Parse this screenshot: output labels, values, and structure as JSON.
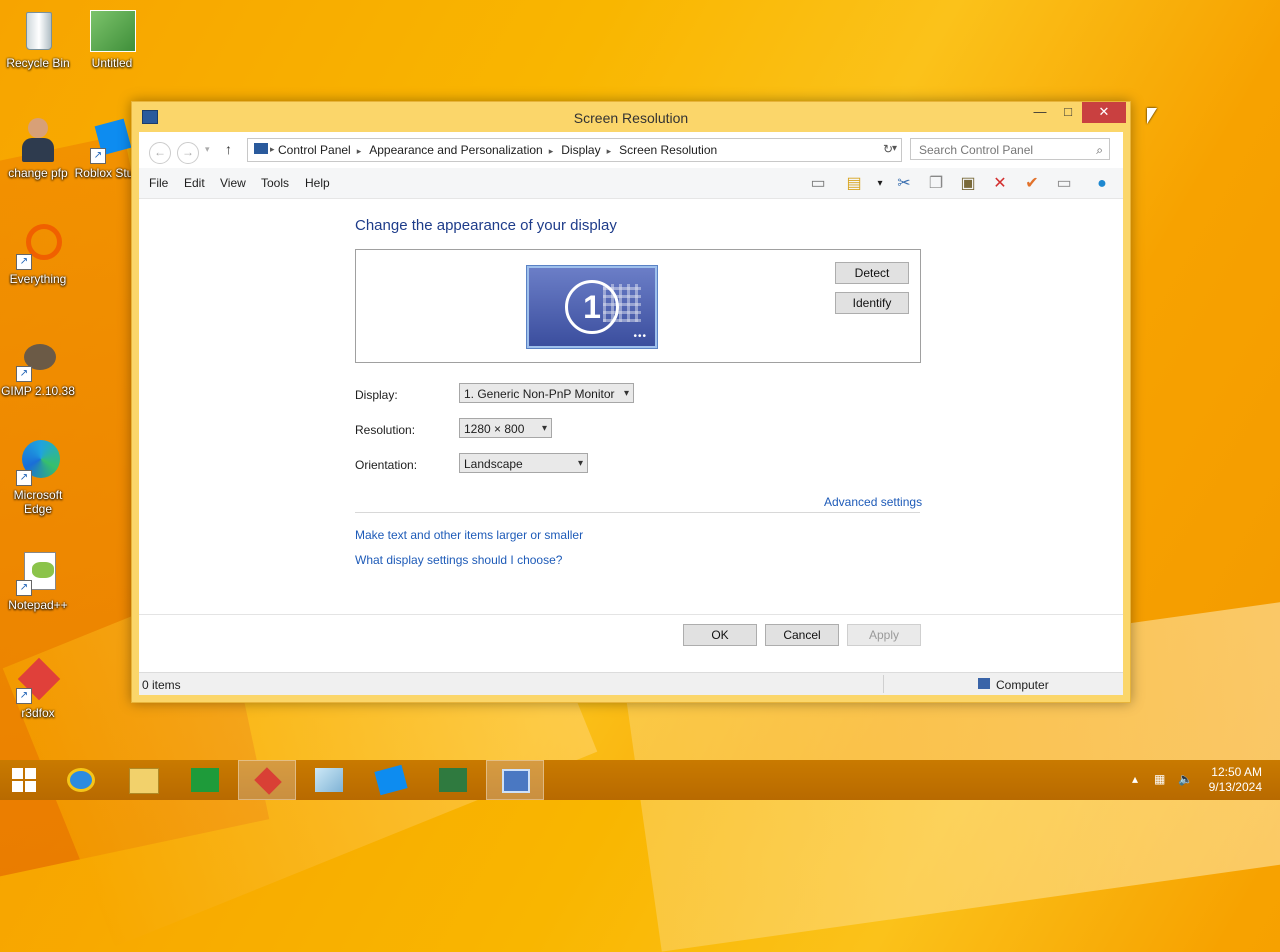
{
  "desktop": {
    "icons": [
      {
        "label": "Recycle Bin"
      },
      {
        "label": "Untitled"
      },
      {
        "label": "change pfp"
      },
      {
        "label": "Roblox Studio"
      },
      {
        "label": "Everything"
      },
      {
        "label": "GIMP 2.10.38"
      },
      {
        "label": "Microsoft Edge"
      },
      {
        "label": "Notepad++"
      },
      {
        "label": "r3dfox"
      }
    ]
  },
  "window": {
    "title": "Screen Resolution",
    "controls": {
      "minimize": "—",
      "maximize": "□",
      "close": "✕"
    },
    "breadcrumb": [
      "Control Panel",
      "Appearance and Personalization",
      "Display",
      "Screen Resolution"
    ],
    "search_placeholder": "Search Control Panel",
    "menu": [
      "File",
      "Edit",
      "View",
      "Tools",
      "Help"
    ],
    "heading": "Change the appearance of your display",
    "monitor_number": "1",
    "detect_label": "Detect",
    "identify_label": "Identify",
    "display_label": "Display:",
    "display_value": "1. Generic Non-PnP Monitor",
    "resolution_label": "Resolution:",
    "resolution_value": "1280 × 800",
    "orientation_label": "Orientation:",
    "orientation_value": "Landscape",
    "advanced_link": "Advanced settings",
    "link_larger": "Make text and other items larger or smaller",
    "link_choose": "What display settings should I choose?",
    "ok_label": "OK",
    "cancel_label": "Cancel",
    "apply_label": "Apply",
    "status_items": "0 items",
    "status_location": "Computer"
  },
  "taskbar": {
    "time": "12:50 AM",
    "date": "9/13/2024",
    "pinned": [
      "start",
      "internet-explorer",
      "file-explorer",
      "store",
      "r3dfox",
      "app-icon",
      "roblox-studio",
      "project",
      "screen-resolution"
    ]
  }
}
